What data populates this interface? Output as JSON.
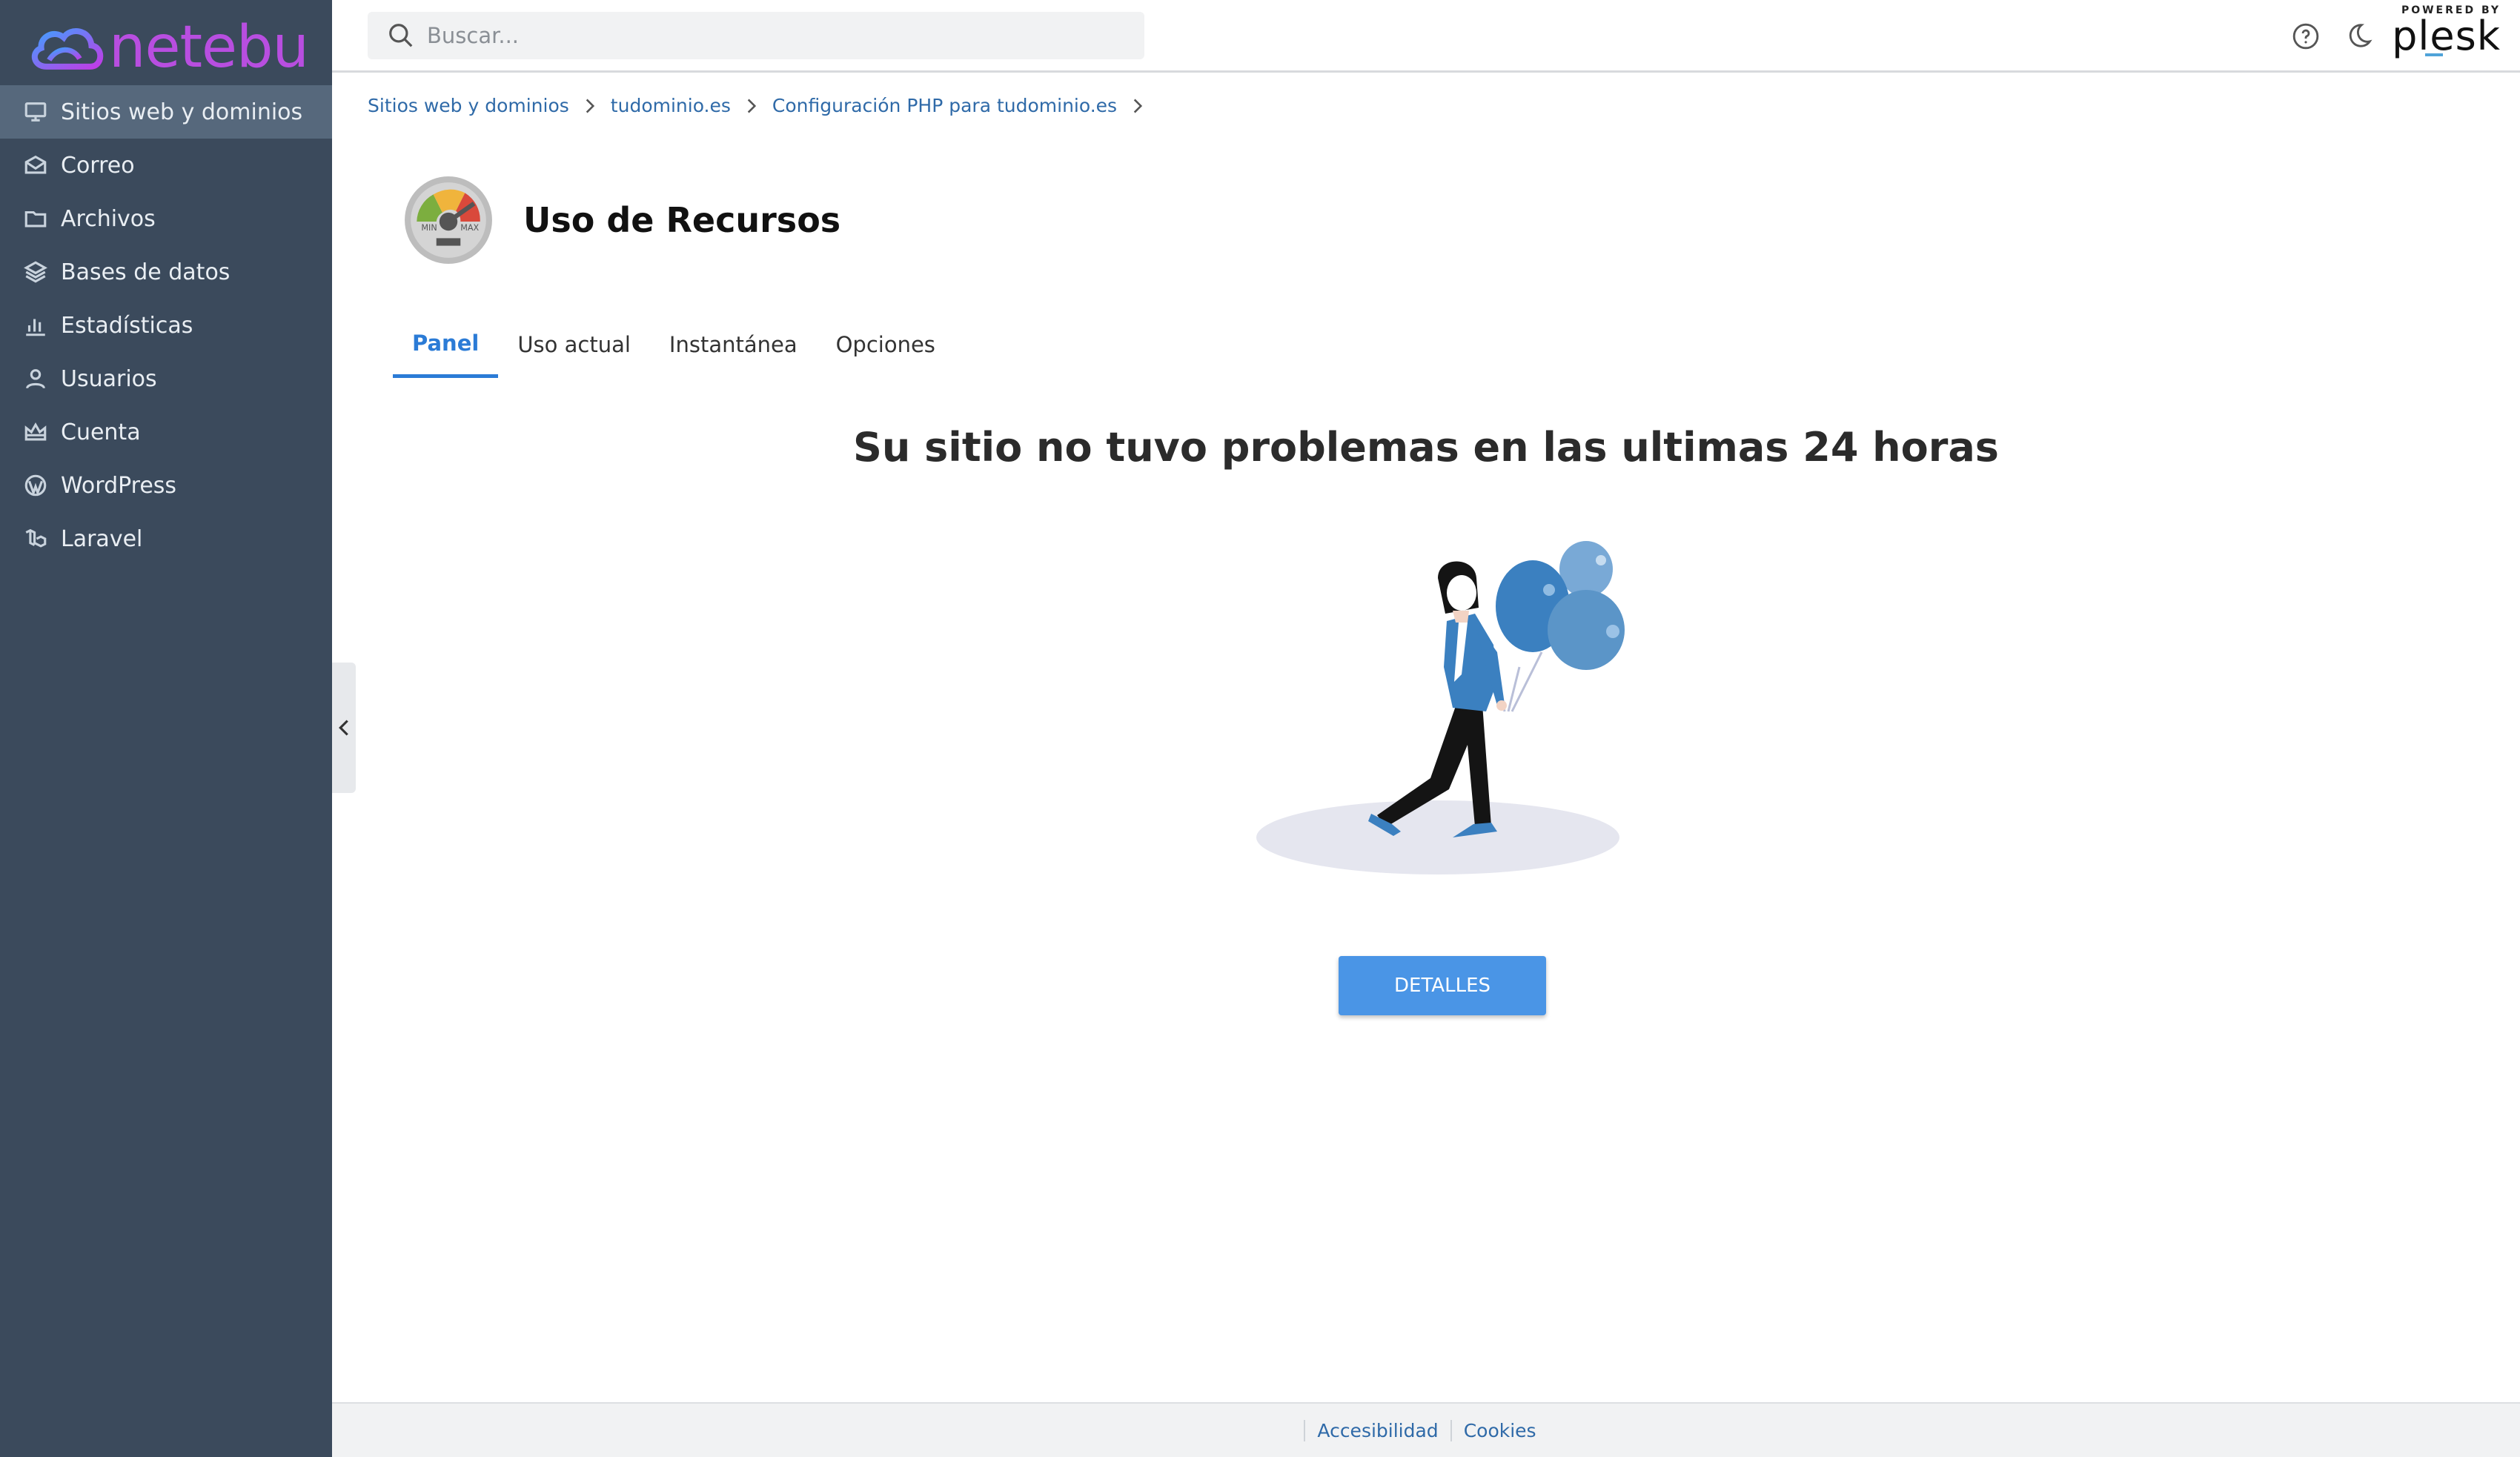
{
  "brand": {
    "name": "netebu",
    "color": "#b84ee0"
  },
  "sidebar": {
    "items": [
      {
        "label": "Sitios web y dominios",
        "icon": "monitor-icon",
        "active": true
      },
      {
        "label": "Correo",
        "icon": "mail-icon"
      },
      {
        "label": "Archivos",
        "icon": "folder-icon"
      },
      {
        "label": "Bases de datos",
        "icon": "layers-icon"
      },
      {
        "label": "Estadísticas",
        "icon": "bar-chart-icon"
      },
      {
        "label": "Usuarios",
        "icon": "user-icon"
      },
      {
        "label": "Cuenta",
        "icon": "crown-icon"
      },
      {
        "label": "WordPress",
        "icon": "wordpress-icon"
      },
      {
        "label": "Laravel",
        "icon": "laravel-icon"
      }
    ]
  },
  "header": {
    "search_placeholder": "Buscar...",
    "powered_by": "POWERED BY",
    "plesk": "plesk"
  },
  "breadcrumb": [
    "Sitios web y dominios",
    "tudominio.es",
    "Configuración PHP para tudominio.es"
  ],
  "page": {
    "title": "Uso de Recursos",
    "gauge_min": "MIN",
    "gauge_max": "MAX",
    "tabs": [
      {
        "label": "Panel",
        "active": true
      },
      {
        "label": "Uso actual"
      },
      {
        "label": "Instantánea"
      },
      {
        "label": "Opciones"
      }
    ],
    "message": "Su sitio no tuvo problemas en las ultimas 24 horas",
    "details_button": "DETALLES"
  },
  "footer": {
    "links": [
      "Accesibilidad",
      "Cookies"
    ]
  },
  "colors": {
    "sidebar_bg": "#3b4a5c",
    "accent": "#2b7bd6",
    "button": "#4a95e6"
  }
}
